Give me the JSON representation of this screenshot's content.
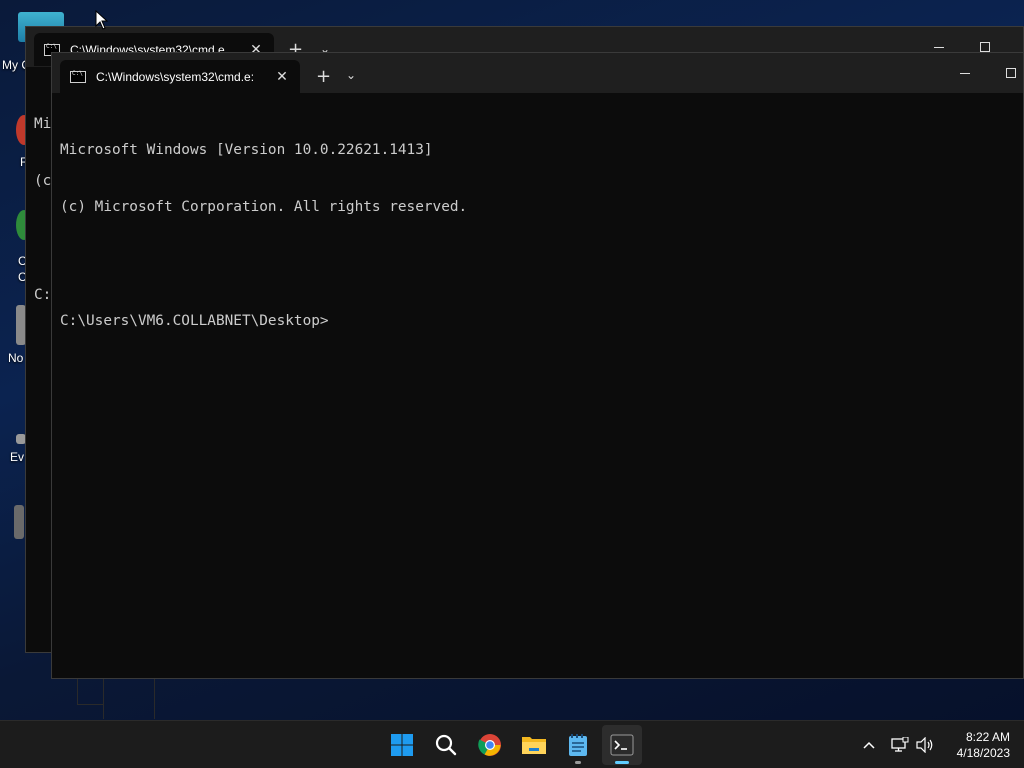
{
  "desktop": {
    "icon_labels": [
      "My C",
      "F",
      "C",
      "C",
      "No",
      "Ev"
    ]
  },
  "back_window": {
    "tab_title": "C:\\Windows\\system32\\cmd.e",
    "console_lines": [
      "Mi",
      "(c",
      "",
      "C:"
    ]
  },
  "front_window": {
    "tab_title": "C:\\Windows\\system32\\cmd.e:",
    "new_tab_label": "+",
    "dropdown_label": "⌄",
    "close_label": "✕",
    "console_lines": [
      "Microsoft Windows [Version 10.0.22621.1413]",
      "(c) Microsoft Corporation. All rights reserved.",
      "",
      "C:\\Users\\VM6.COLLABNET\\Desktop>"
    ]
  },
  "taskbar": {
    "apps": [
      {
        "icon": "windows-start-icon"
      },
      {
        "icon": "search-icon"
      },
      {
        "icon": "chrome-icon"
      },
      {
        "icon": "file-explorer-icon"
      },
      {
        "icon": "notepad-icon"
      },
      {
        "icon": "terminal-icon",
        "active": true
      }
    ],
    "tray": {
      "chevron": "^",
      "time": "8:22 AM",
      "date": "4/18/2023"
    }
  },
  "colors": {
    "terminal_bg": "#0c0c0c",
    "terminal_text": "#cccccc",
    "titlebar": "#1f1f1f",
    "taskbar": "#1c1c1c",
    "accent": "#60cdff"
  }
}
